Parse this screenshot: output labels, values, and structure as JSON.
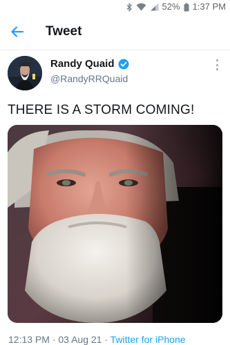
{
  "status_bar": {
    "battery": "52%",
    "time": "1:37 PM",
    "icons": [
      "bluetooth-icon",
      "wifi-icon",
      "signal-icon",
      "battery-icon"
    ]
  },
  "app_bar": {
    "back_icon": "back-arrow-icon",
    "title": "Tweet",
    "accent_color": "#1da1f2"
  },
  "tweet": {
    "author": {
      "display_name": "Randy Quaid",
      "handle": "@RandyRRQuaid",
      "verified": true
    },
    "text": "THERE IS A STORM COMING!",
    "media": {
      "type": "photo"
    },
    "time": "12:13 PM",
    "separator": "·",
    "date": "03 Aug 21",
    "source": "Twitter for iPhone"
  }
}
